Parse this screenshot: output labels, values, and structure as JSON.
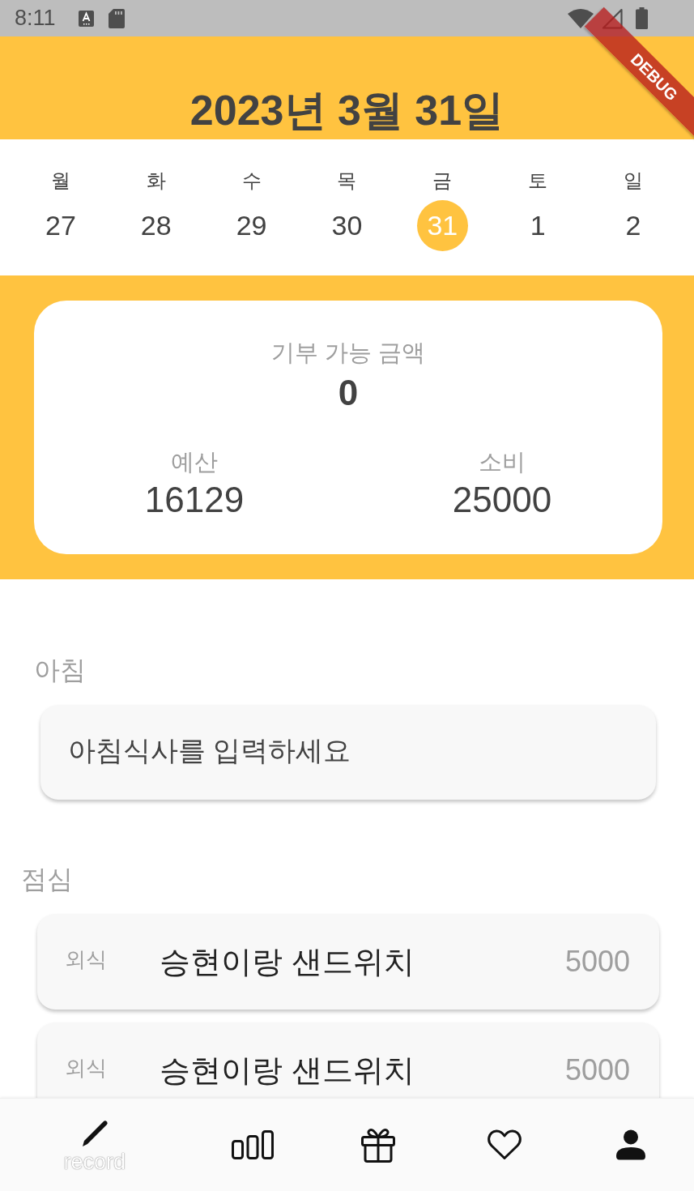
{
  "status_bar": {
    "time": "8:11"
  },
  "debug_banner": {
    "label": "DEBUG"
  },
  "header": {
    "title": "2023년 3월 31일"
  },
  "week": {
    "days": [
      {
        "weekday": "월",
        "date": "27",
        "selected": false
      },
      {
        "weekday": "화",
        "date": "28",
        "selected": false
      },
      {
        "weekday": "수",
        "date": "29",
        "selected": false
      },
      {
        "weekday": "목",
        "date": "30",
        "selected": false
      },
      {
        "weekday": "금",
        "date": "31",
        "selected": true
      },
      {
        "weekday": "토",
        "date": "1",
        "selected": false
      },
      {
        "weekday": "일",
        "date": "2",
        "selected": false
      }
    ]
  },
  "summary": {
    "donation": {
      "label": "기부 가능 금액",
      "value": "0"
    },
    "stats": [
      {
        "label": "예산",
        "value": "16129"
      },
      {
        "label": "소비",
        "value": "25000"
      }
    ]
  },
  "meals": [
    {
      "kind": "prompt",
      "title": "아침",
      "prompt": "아침식사를 입력하세요"
    },
    {
      "kind": "entries",
      "title": "점심",
      "entries": [
        {
          "category": "외식",
          "name": "승현이랑 샌드위치",
          "price": "5000"
        },
        {
          "category": "외식",
          "name": "승현이랑 샌드위치",
          "price": "5000"
        }
      ]
    }
  ],
  "bottom_nav": {
    "items": [
      {
        "kind": "pencil",
        "label": "record",
        "selected": true
      },
      {
        "kind": "bars",
        "selected": false
      },
      {
        "kind": "gift",
        "selected": false
      },
      {
        "kind": "heart",
        "selected": false
      },
      {
        "kind": "person",
        "selected": false
      }
    ]
  }
}
